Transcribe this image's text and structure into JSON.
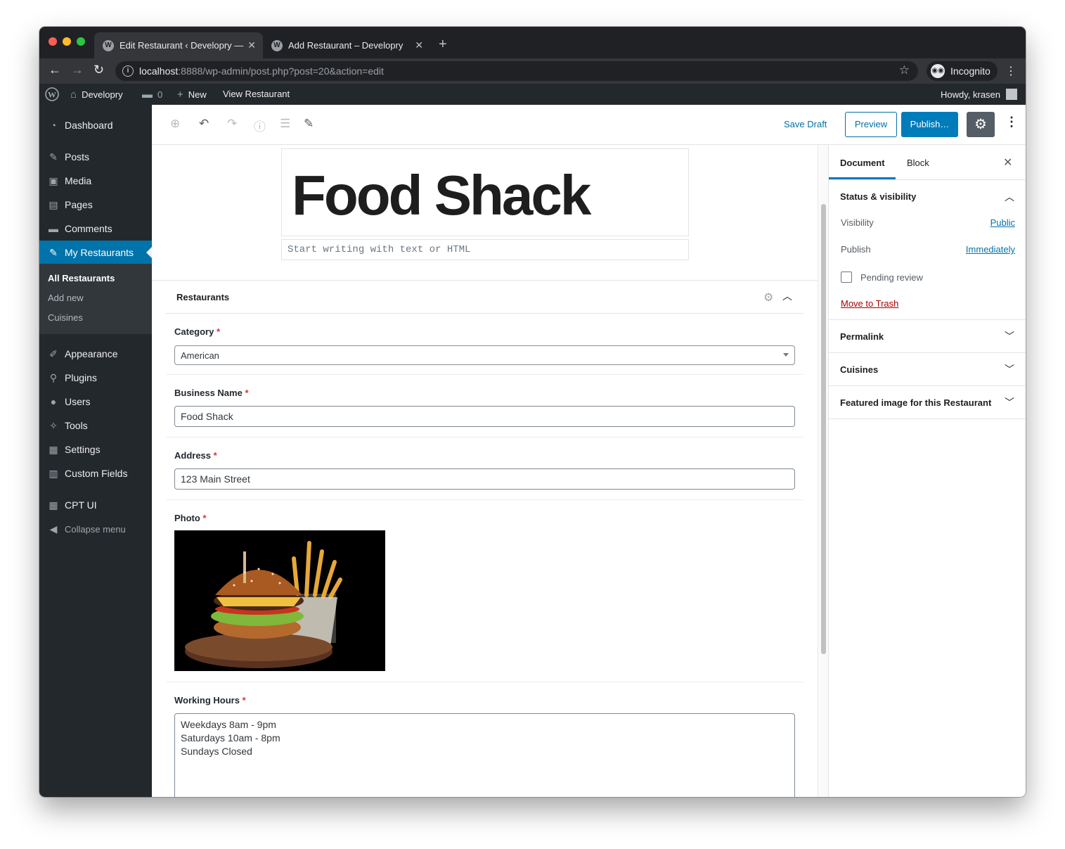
{
  "browser": {
    "tabs": [
      {
        "title": "Edit Restaurant ‹ Developry —",
        "active": true
      },
      {
        "title": "Add Restaurant – Developry",
        "active": false
      }
    ],
    "url_host": "localhost",
    "url_rest": ":8888/wp-admin/post.php?post=20&action=edit",
    "incognito_label": "Incognito",
    "colors": {
      "close": "#ff5f57",
      "minimize": "#febc2e",
      "zoom": "#28c840"
    }
  },
  "adminbar": {
    "site_name": "Developry",
    "comments_count": "0",
    "new_label": "New",
    "view_label": "View Restaurant",
    "howdy": "Howdy, krasen"
  },
  "sidebar": {
    "items": [
      {
        "label": "Dashboard",
        "icon": "dashboard-icon"
      },
      {
        "label": "Posts",
        "icon": "pin-icon"
      },
      {
        "label": "Media",
        "icon": "media-icon"
      },
      {
        "label": "Pages",
        "icon": "pages-icon"
      },
      {
        "label": "Comments",
        "icon": "comment-icon"
      },
      {
        "label": "My Restaurants",
        "icon": "pin-icon"
      },
      {
        "label": "Appearance",
        "icon": "brush-icon"
      },
      {
        "label": "Plugins",
        "icon": "plug-icon"
      },
      {
        "label": "Users",
        "icon": "user-icon"
      },
      {
        "label": "Tools",
        "icon": "wrench-icon"
      },
      {
        "label": "Settings",
        "icon": "sliders-icon"
      },
      {
        "label": "Custom Fields",
        "icon": "grid-icon"
      },
      {
        "label": "CPT UI",
        "icon": "cpt-icon"
      },
      {
        "label": "Collapse menu",
        "icon": "collapse-icon"
      }
    ],
    "submenu": [
      "All Restaurants",
      "Add new",
      "Cuisines"
    ]
  },
  "editor": {
    "save_draft": "Save Draft",
    "preview": "Preview",
    "publish": "Publish…",
    "post_title": "Food Shack",
    "appender_placeholder": "Start writing with text or HTML",
    "metabox_title": "Restaurants",
    "fields": {
      "category": {
        "label": "Category",
        "value": "American"
      },
      "business_name": {
        "label": "Business Name",
        "value": "Food Shack"
      },
      "address": {
        "label": "Address",
        "value": "123 Main Street"
      },
      "photo": {
        "label": "Photo"
      },
      "working_hours": {
        "label": "Working Hours",
        "lines": [
          "Weekdays 8am - 9pm",
          "Saturdays 10am - 8pm",
          "Sundays Closed"
        ]
      }
    },
    "required_mark": "*"
  },
  "settings_sidebar": {
    "tabs": [
      "Document",
      "Block"
    ],
    "status_panel": {
      "title": "Status & visibility",
      "visibility_label": "Visibility",
      "visibility_value": "Public",
      "publish_label": "Publish",
      "publish_value": "Immediately",
      "pending_label": "Pending review",
      "trash_label": "Move to Trash"
    },
    "panels": [
      "Permalink",
      "Cuisines",
      "Featured image for this Restaurant"
    ]
  }
}
